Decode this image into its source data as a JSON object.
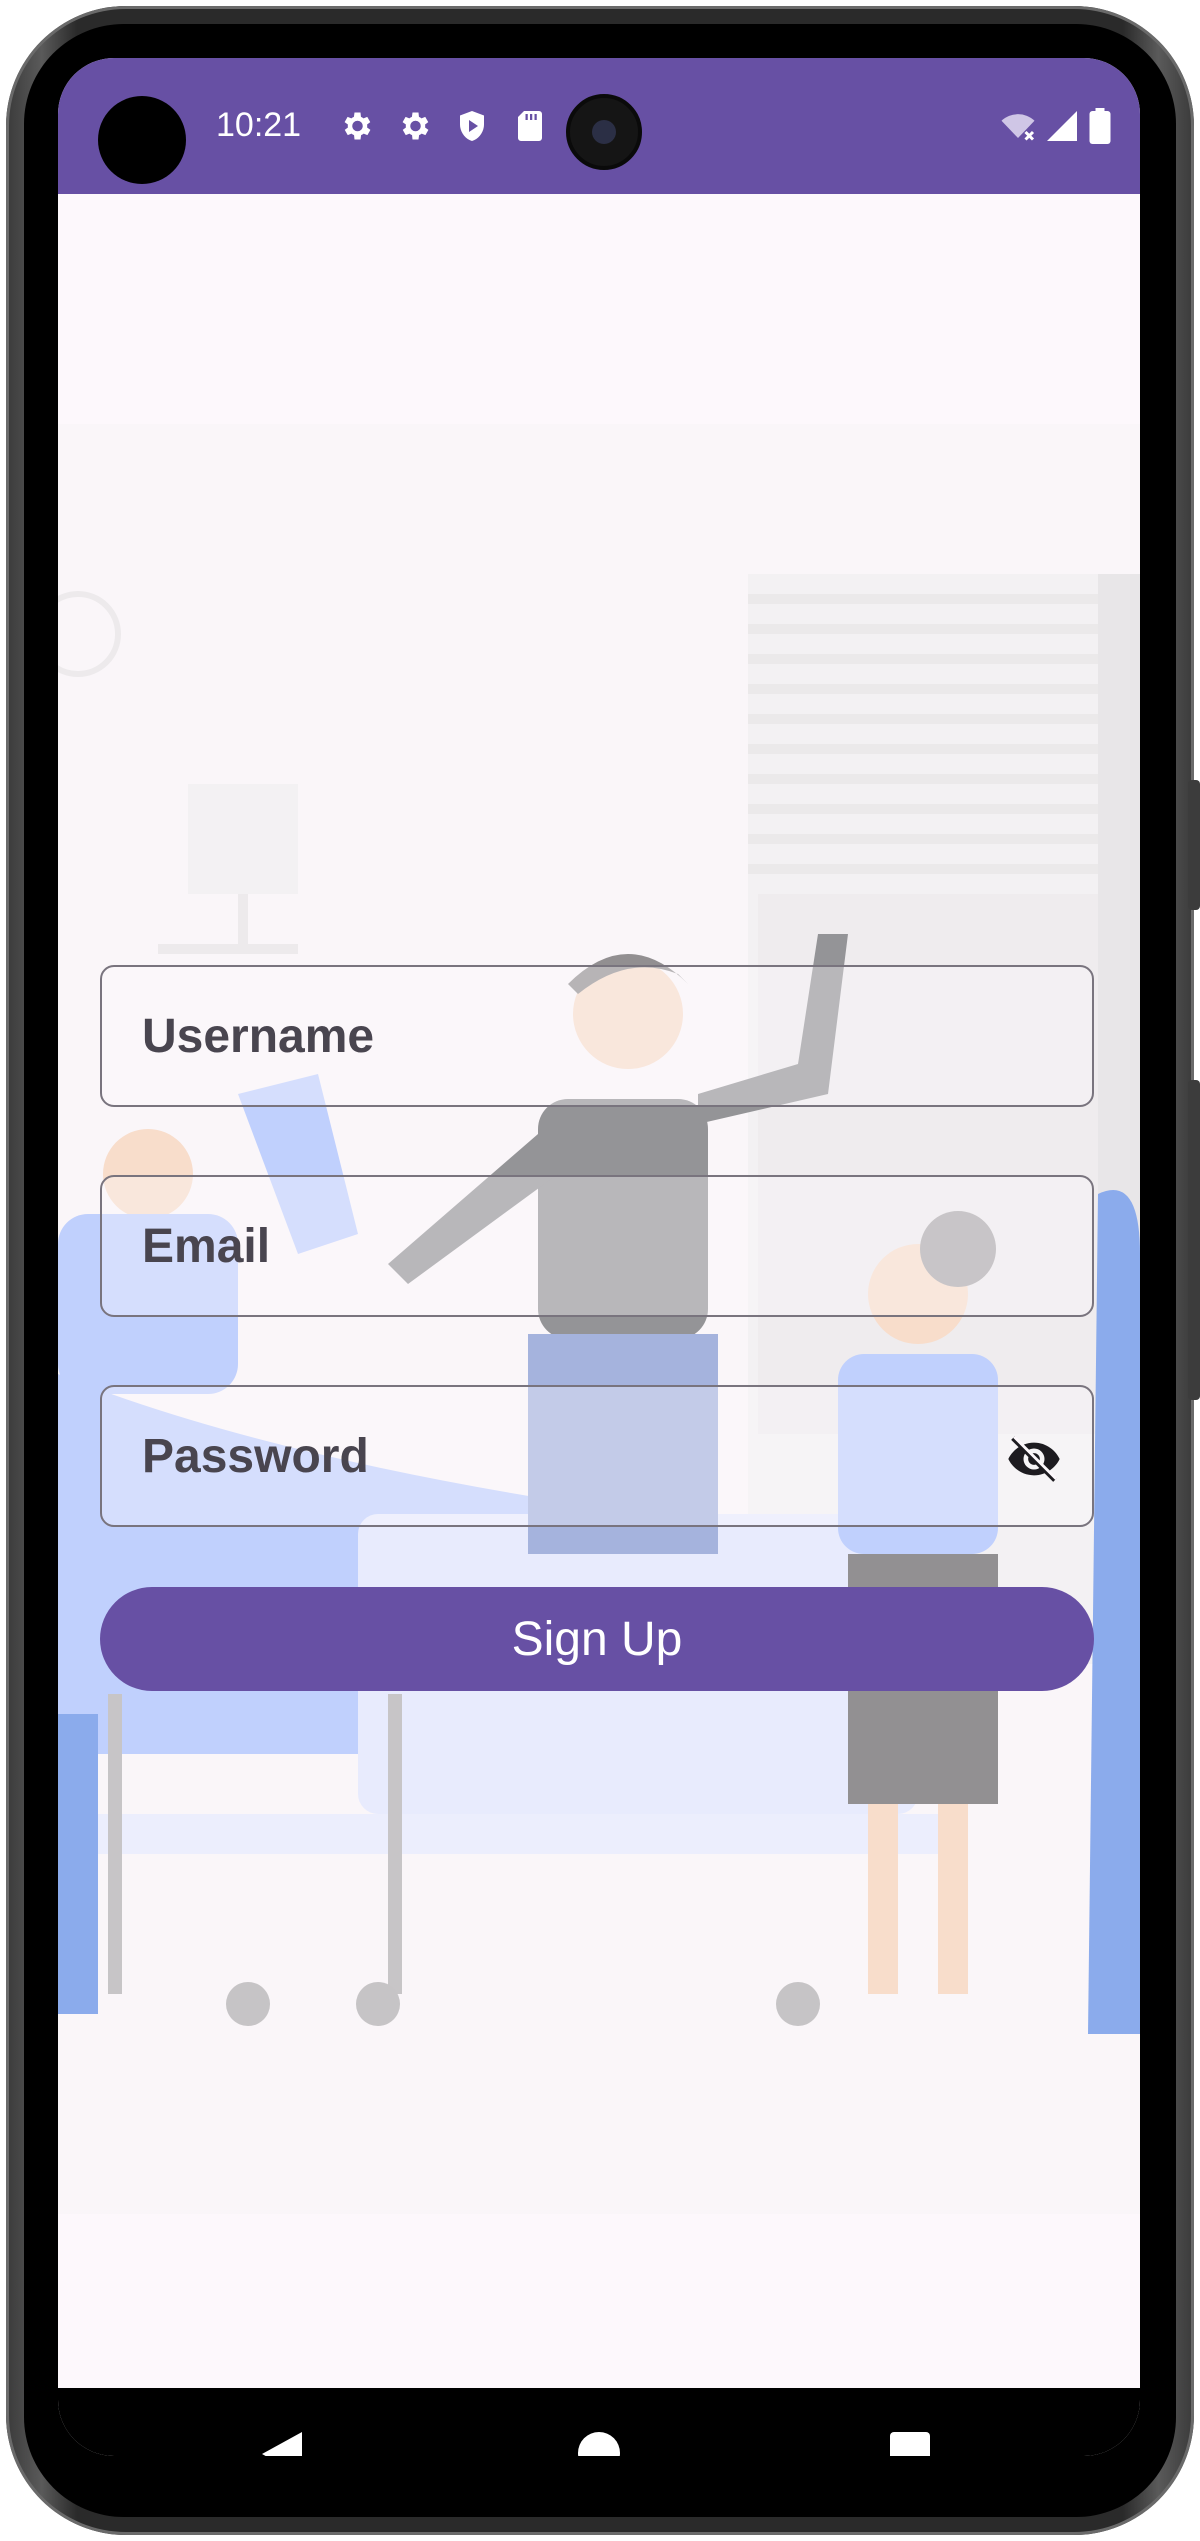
{
  "status_bar": {
    "time": "10:21",
    "icons": [
      "gear-icon",
      "gear-icon",
      "shield-play-icon",
      "sd-card-icon",
      "wifi-off-icon",
      "cell-signal-icon",
      "battery-icon"
    ],
    "background": "#6750a4"
  },
  "form": {
    "username_label": "Username",
    "email_label": "Email",
    "password_label": "Password",
    "password_visibility_icon": "eye-off-icon",
    "signup_label": "Sign Up"
  },
  "navigation": {
    "icons": [
      "back-icon",
      "home-icon",
      "recents-icon"
    ]
  },
  "colors": {
    "accent": "#6750a4",
    "surface": "#fdf8fc",
    "outline": "#79747e",
    "label": "#49454f"
  }
}
